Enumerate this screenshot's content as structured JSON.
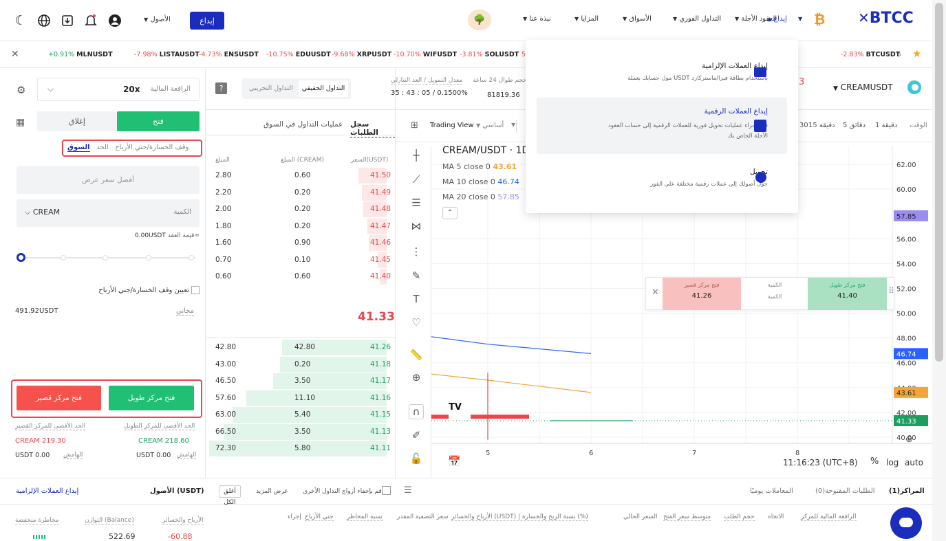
{
  "header": {
    "logo": "BTCC",
    "nav": [
      "إيداع",
      "العقود الأجلة",
      "التداول الفوري",
      "الأسواق",
      "المزايا",
      "نبذة عنا"
    ],
    "deposit_button": "إيداع",
    "assets_menu": "الأصول",
    "promo_emoji": "🌳"
  },
  "ticker": [
    {
      "pct": "+0.91%",
      "sym": "MLNUSDT",
      "tone": "pos"
    },
    {
      "pct": "-7.98%",
      "sym": "LISTAUSDT",
      "tone": "neg"
    },
    {
      "pct": "-4.73%",
      "sym": "ENSUSDT",
      "tone": "neg"
    },
    {
      "pct": "-10.75%",
      "sym": "EDUUSDT",
      "tone": "neg"
    },
    {
      "pct": "-9.68%",
      "sym": "XRPUSDT",
      "tone": "neg"
    },
    {
      "pct": "-10.70%",
      "sym": "WIFUSDT",
      "tone": "neg"
    },
    {
      "pct": "-3.81%",
      "sym": "SOLUSDT",
      "tone": "neg"
    },
    {
      "pct": "5",
      "sym": "",
      "tone": "neg"
    },
    {
      "pct": "-2.83%",
      "sym": "BTCUSDT",
      "tone": "neg"
    }
  ],
  "left": {
    "leverage_label": "الرافعة المالية",
    "leverage_value": "20x",
    "tab_open": "فتح",
    "tab_close": "إغلاق",
    "order_types": [
      "السوق",
      "الحد",
      "وقف الخسارة/جني الأرباح"
    ],
    "best_price_placeholder": "أفضل سعر عرض",
    "quantity_label": "الكمية",
    "quantity_unit": "CREAM",
    "margin_label": "قيمة العقد≈",
    "margin_value": "0.00USDT",
    "tpsl_checkbox": "تعيين وقف الخسارة/جني الأرباح",
    "free_label": "مجاني",
    "free_value": "491.92USDT",
    "open_long": "فتح مركز طويل",
    "open_short": "فتح مركز قصير",
    "max_long_label": "الحد الأقصى للمركز الطويل",
    "max_long_value": "CREAM 218.60",
    "max_short_label": "الحد الأقصى للمركز القصير",
    "max_short_value": "CREAM 219.30",
    "margin1_label": "الهامش",
    "margin1_value": "USDT 0.00",
    "margin2_label": "الهامش",
    "margin2_value": "USDT 0.00"
  },
  "symbol_bar": {
    "symbol": "CREAMUSDT",
    "sim_tab": "التداول التجريبي",
    "real_tab": "التداول الحقيقي",
    "funding_label": "معدل التمويل / العد التنازلي",
    "funding_value": "35 : 43 : 05 / 0.1500%",
    "vol_label": "حجم طوال 24 ساعة",
    "vol_value": "81819.36",
    "help": "?"
  },
  "orderbook": {
    "tab_book": "سجل الطلبات",
    "tab_trades": "عمليات التداول في السوق",
    "headers": [
      "السعر(USDT)",
      "المبلغ (CREAM)",
      "المبلغ"
    ],
    "asks": [
      {
        "price": "41.50",
        "amount": "0.60",
        "total": "2.80",
        "depth": 0.16
      },
      {
        "price": "41.49",
        "amount": "0.20",
        "total": "2.20",
        "depth": 0.14
      },
      {
        "price": "41.48",
        "amount": "0.20",
        "total": "2.00",
        "depth": 0.13
      },
      {
        "price": "41.47",
        "amount": "0.20",
        "total": "1.80",
        "depth": 0.11
      },
      {
        "price": "41.46",
        "amount": "0.90",
        "total": "1.60",
        "depth": 0.1
      },
      {
        "price": "41.45",
        "amount": "0.10",
        "total": "0.70",
        "depth": 0.05
      },
      {
        "price": "41.40",
        "amount": "0.60",
        "total": "0.60",
        "depth": 0.04
      }
    ],
    "mid_price": "41.33",
    "bids": [
      {
        "price": "41.26",
        "amount": "42.80",
        "total": "42.80",
        "depth": 0.59
      },
      {
        "price": "41.18",
        "amount": "0.20",
        "total": "43.00",
        "depth": 0.6
      },
      {
        "price": "41.17",
        "amount": "3.50",
        "total": "46.50",
        "depth": 0.64
      },
      {
        "price": "41.16",
        "amount": "11.10",
        "total": "57.60",
        "depth": 0.79
      },
      {
        "price": "41.15",
        "amount": "5.40",
        "total": "63.00",
        "depth": 0.87
      },
      {
        "price": "41.13",
        "amount": "3.50",
        "total": "66.50",
        "depth": 0.92
      },
      {
        "price": "41.11",
        "amount": "5.80",
        "total": "72.30",
        "depth": 1.0
      }
    ]
  },
  "chart": {
    "timeframes": [
      "الوقت",
      "1 دقيقة",
      "5 دقائق",
      "15 دقيقة",
      "30"
    ],
    "tv_tab": "Trading View",
    "basic_tab": "أساسي",
    "title": "CREAM/USDT · 1D",
    "ma5": "MA 5 close 0",
    "ma5_val": "43.61",
    "ma10": "MA 10 close 0",
    "ma10_val": "46.74",
    "ma20": "MA 20 close 0",
    "ma20_val": "57.85",
    "y_ticks": [
      "62.00",
      "60.00",
      "56.00",
      "54.00",
      "52.00",
      "50.00",
      "48.00",
      "46.00",
      "44.00",
      "42.00",
      "40.00"
    ],
    "y_tick_values": [
      62,
      60,
      56,
      54,
      52,
      50,
      48,
      46,
      44,
      42,
      40
    ],
    "ylim": [
      39.5,
      63.5
    ],
    "price_tags": [
      {
        "label": "57.85",
        "value": 57.85,
        "color": "#9b8cf0",
        "text": "#222"
      },
      {
        "label": "46.74",
        "value": 46.74,
        "color": "#2962ff",
        "text": "#fff"
      },
      {
        "label": "43.61",
        "value": 43.61,
        "color": "#f2a53a",
        "text": "#222"
      },
      {
        "label": "41.33",
        "value": 41.33,
        "color": "#1d9e60",
        "text": "#fff"
      }
    ],
    "x_ticks": [
      "5",
      "6",
      "7",
      "8"
    ],
    "ma10_line": [
      [
        4.0,
        48.6
      ],
      [
        5.0,
        47.5
      ],
      [
        6.0,
        46.74
      ]
    ],
    "ma5_line": [
      [
        4.0,
        45.5
      ],
      [
        5.0,
        44.6
      ],
      [
        6.0,
        43.61
      ]
    ],
    "candle_line": {
      "x": 5.0,
      "top": 45.2,
      "bottom": 39.8
    },
    "red_bar": {
      "from": 4.3,
      "to": 5.4,
      "value": 41.65
    },
    "green_line": {
      "from": 5.6,
      "to": 6.4,
      "value": 41.33
    },
    "quick": {
      "short_label": "فتح مركز قصير",
      "short_price": "41.26",
      "qty_label": "الكمية",
      "qty_label2": "الكمية",
      "long_label": "فتح مركز طويل",
      "long_price": "41.40"
    },
    "clock": "11:16:23 (UTC+8)",
    "pct": "%",
    "log": "log",
    "auto": "auto"
  },
  "dropdown": [
    {
      "title": "إيداع العملات الإلزامية",
      "desc": "مول حسابك بعملة USDT باستخدام بطاقة فيزا/ماستركارد"
    },
    {
      "title": "إيداع العملات الرقمية",
      "desc": "قم بإجراء عمليات تحويل فورية للعملات الرقمية إلى حساب العقود الأجلة الخاص بك"
    },
    {
      "title": "تحويل",
      "desc": "حول أصولك إلى عملات رقمية مختلفة على الفور"
    }
  ],
  "bottom": {
    "tabs": [
      "المراكز(1)",
      "الطلبات المفتوحة(0)",
      "المعاملات يوميًا"
    ],
    "hide_pairs": "قم بإخفاء أزواج التداول الأخرى",
    "show_more": "عرض المزيد",
    "close_all": "أغلق الكل",
    "cols": [
      "الرافعة المالية للمركز",
      "الاتجاه",
      "حجم الطلب",
      "متوسط سعر الفتح",
      "السعر الحالي",
      "الأرباح والخسائر (USDT) | نسبة الربح والخسارة (%)",
      "سعر التصفية المقدر",
      "نسبة المخاطر",
      "جني الأرباح",
      "إجراء"
    ],
    "assets_title": "الأصول (USDT)",
    "deposit_link": "إيداع العملات الإلزامية",
    "pnl_label": "الأرباح والخسائر",
    "balance_label": "التوازن (Balance)",
    "risk_label": "مخاطرة منخفضة",
    "pnl_value": "-60.88",
    "balance_value": "522.69"
  }
}
